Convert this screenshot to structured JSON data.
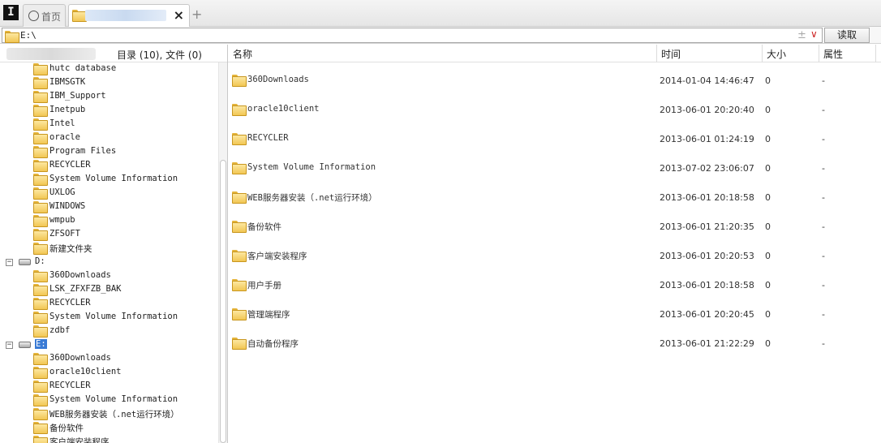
{
  "tabs": {
    "home_label": "首页",
    "close_symbol": "×",
    "add_symbol": "+"
  },
  "address": {
    "path": "E:\\",
    "plus_symbol": "±",
    "dropdown_symbol": "∨",
    "read_label": "读取"
  },
  "left": {
    "summary": "目录 (10), 文件 (0)",
    "tree": [
      {
        "type": "folder",
        "label": "hutc database"
      },
      {
        "type": "folder",
        "label": "IBMSGTK"
      },
      {
        "type": "folder",
        "label": "IBM_Support"
      },
      {
        "type": "folder",
        "label": "Inetpub"
      },
      {
        "type": "folder",
        "label": "Intel"
      },
      {
        "type": "folder",
        "label": "oracle"
      },
      {
        "type": "folder",
        "label": "Program Files"
      },
      {
        "type": "folder",
        "label": "RECYCLER"
      },
      {
        "type": "folder",
        "label": "System Volume Information"
      },
      {
        "type": "folder",
        "label": "UXLOG"
      },
      {
        "type": "folder",
        "label": "WINDOWS"
      },
      {
        "type": "folder",
        "label": "wmpub"
      },
      {
        "type": "folder",
        "label": "ZFSOFT"
      },
      {
        "type": "folder",
        "label": "新建文件夹"
      },
      {
        "type": "drive",
        "label": "D:"
      },
      {
        "type": "folder",
        "label": "360Downloads"
      },
      {
        "type": "folder",
        "label": "LSK_ZFXFZB_BAK"
      },
      {
        "type": "folder",
        "label": "RECYCLER"
      },
      {
        "type": "folder",
        "label": "System Volume Information"
      },
      {
        "type": "folder",
        "label": "zdbf"
      },
      {
        "type": "drive",
        "label": "E:",
        "selected": true
      },
      {
        "type": "folder",
        "label": "360Downloads"
      },
      {
        "type": "folder",
        "label": "oracle10client"
      },
      {
        "type": "folder",
        "label": "RECYCLER"
      },
      {
        "type": "folder",
        "label": "System Volume Information"
      },
      {
        "type": "folder",
        "label": "WEB服务器安装（.net运行环境）"
      },
      {
        "type": "folder",
        "label": "备份软件"
      },
      {
        "type": "folder",
        "label": "客户端安装程序"
      }
    ]
  },
  "columns": {
    "name": "名称",
    "time": "时间",
    "size": "大小",
    "attr": "属性"
  },
  "files": [
    {
      "name": "360Downloads",
      "time": "2014-01-04 14:46:47",
      "size": "0",
      "attr": "-"
    },
    {
      "name": "oracle10client",
      "time": "2013-06-01 20:20:40",
      "size": "0",
      "attr": "-"
    },
    {
      "name": "RECYCLER",
      "time": "2013-06-01 01:24:19",
      "size": "0",
      "attr": "-"
    },
    {
      "name": "System Volume Information",
      "time": "2013-07-02 23:06:07",
      "size": "0",
      "attr": "-"
    },
    {
      "name": "WEB服务器安装（.net运行环境）",
      "time": "2013-06-01 20:18:58",
      "size": "0",
      "attr": "-"
    },
    {
      "name": "备份软件",
      "time": "2013-06-01 21:20:35",
      "size": "0",
      "attr": "-"
    },
    {
      "name": "客户端安装程序",
      "time": "2013-06-01 20:20:53",
      "size": "0",
      "attr": "-"
    },
    {
      "name": "用户手册",
      "time": "2013-06-01 20:18:58",
      "size": "0",
      "attr": "-"
    },
    {
      "name": "管理端程序",
      "time": "2013-06-01 20:20:45",
      "size": "0",
      "attr": "-"
    },
    {
      "name": "自动备份程序",
      "time": "2013-06-01 21:22:29",
      "size": "0",
      "attr": "-"
    }
  ]
}
